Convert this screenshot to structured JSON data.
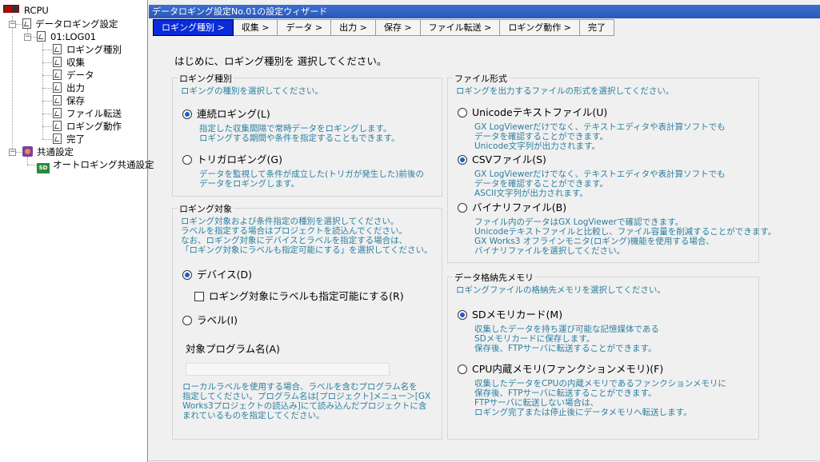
{
  "tree": {
    "root": "RCPU",
    "logging_settings": "データロギング設定",
    "log01": "01:LOG01",
    "items": [
      "ロギング種別",
      "収集",
      "データ",
      "出力",
      "保存",
      "ファイル転送",
      "ロギング動作",
      "完了"
    ],
    "common": "共通設定",
    "auto_common": "オートロギング共通設定"
  },
  "window_title": "データロギング設定No.01の設定ウィザード",
  "tabs": [
    "ロギング種別 >",
    "収集 >",
    "データ >",
    "出力 >",
    "保存 >",
    "ファイル転送 >",
    "ロギング動作 >",
    "完了"
  ],
  "intro": "はじめに、ロギング種別を 選択してください。",
  "logging_type": {
    "title": "ロギング種別",
    "desc": "ロギングの種別を選択してください。",
    "continuous_label": "連続ロギング(L)",
    "continuous_desc": "指定した収集間隔で常時データをロギングします。\nロギングする期間や条件を指定することもできます。",
    "trigger_label": "トリガロギング(G)",
    "trigger_desc": "データを監視して条件が成立した(トリガが発生した)前後の\nデータをロギングします。",
    "selected": "continuous"
  },
  "logging_target": {
    "title": "ロギング対象",
    "desc": "ロギング対象および条件指定の種別を選択してください。\nラベルを指定する場合はプロジェクトを読込んでください。\nなお、ロギング対象にデバイスとラベルを指定する場合は、\n「ロギング対象にラベルも指定可能にする」を選択してください。",
    "device_label": "デバイス(D)",
    "also_label_label": "ロギング対象にラベルも指定可能にする(R)",
    "label_label": "ラベル(I)",
    "program_name_label": "対象プログラム名(A)",
    "program_name_value": "",
    "program_desc": "ローカルラベルを使用する場合、ラベルを含むプログラム名を\n指定してください。プログラム名は[プロジェクト]メニュー＞[GX\nWorks3プロジェクトの読込み]にて読み込んだプロジェクトに含\nまれているものを指定してください。",
    "selected": "device",
    "also_label_checked": false
  },
  "file_format": {
    "title": "ファイル形式",
    "desc": "ロギングを出力するファイルの形式を選択してください。",
    "unicode_label": "Unicodeテキストファイル(U)",
    "unicode_desc": "GX LogViewerだけでなく、テキストエディタや表計算ソフトでも\nデータを確認することができます。\nUnicode文字列が出力されます。",
    "csv_label": "CSVファイル(S)",
    "csv_desc": "GX LogViewerだけでなく、テキストエディタや表計算ソフトでも\nデータを確認することができます。\nASCII文字列が出力されます。",
    "binary_label": "バイナリファイル(B)",
    "binary_desc": "ファイル内のデータはGX LogViewerで確認できます。\nUnicodeテキストファイルと比較し、ファイル容量を削減することができます。\nGX Works3 オフラインモニタ(ロギング)機能を使用する場合、\nバイナリファイルを選択してください。",
    "selected": "csv"
  },
  "storage": {
    "title": "データ格納先メモリ",
    "desc": "ロギングファイルの格納先メモリを選択してください。",
    "sd_label": "SDメモリカード(M)",
    "sd_desc": "収集したデータを持ち運び可能な記憶媒体である\nSDメモリカードに保存します。\n保存後、FTPサーバに転送することができます。",
    "cpu_label": "CPU内蔵メモリ(ファンクションメモリ)(F)",
    "cpu_desc": "収集したデータをCPUの内蔵メモリであるファンクションメモリに\n保存後、FTPサーバに転送することができます。\nFTPサーバに転送しない場合は、\nロギング完了または停止後にデータメモリへ転送します。",
    "selected": "sd"
  },
  "colors": {
    "accent": "#0a2bd8",
    "desc_text": "#2a7fa0",
    "title_bar": "#2a58b8"
  }
}
